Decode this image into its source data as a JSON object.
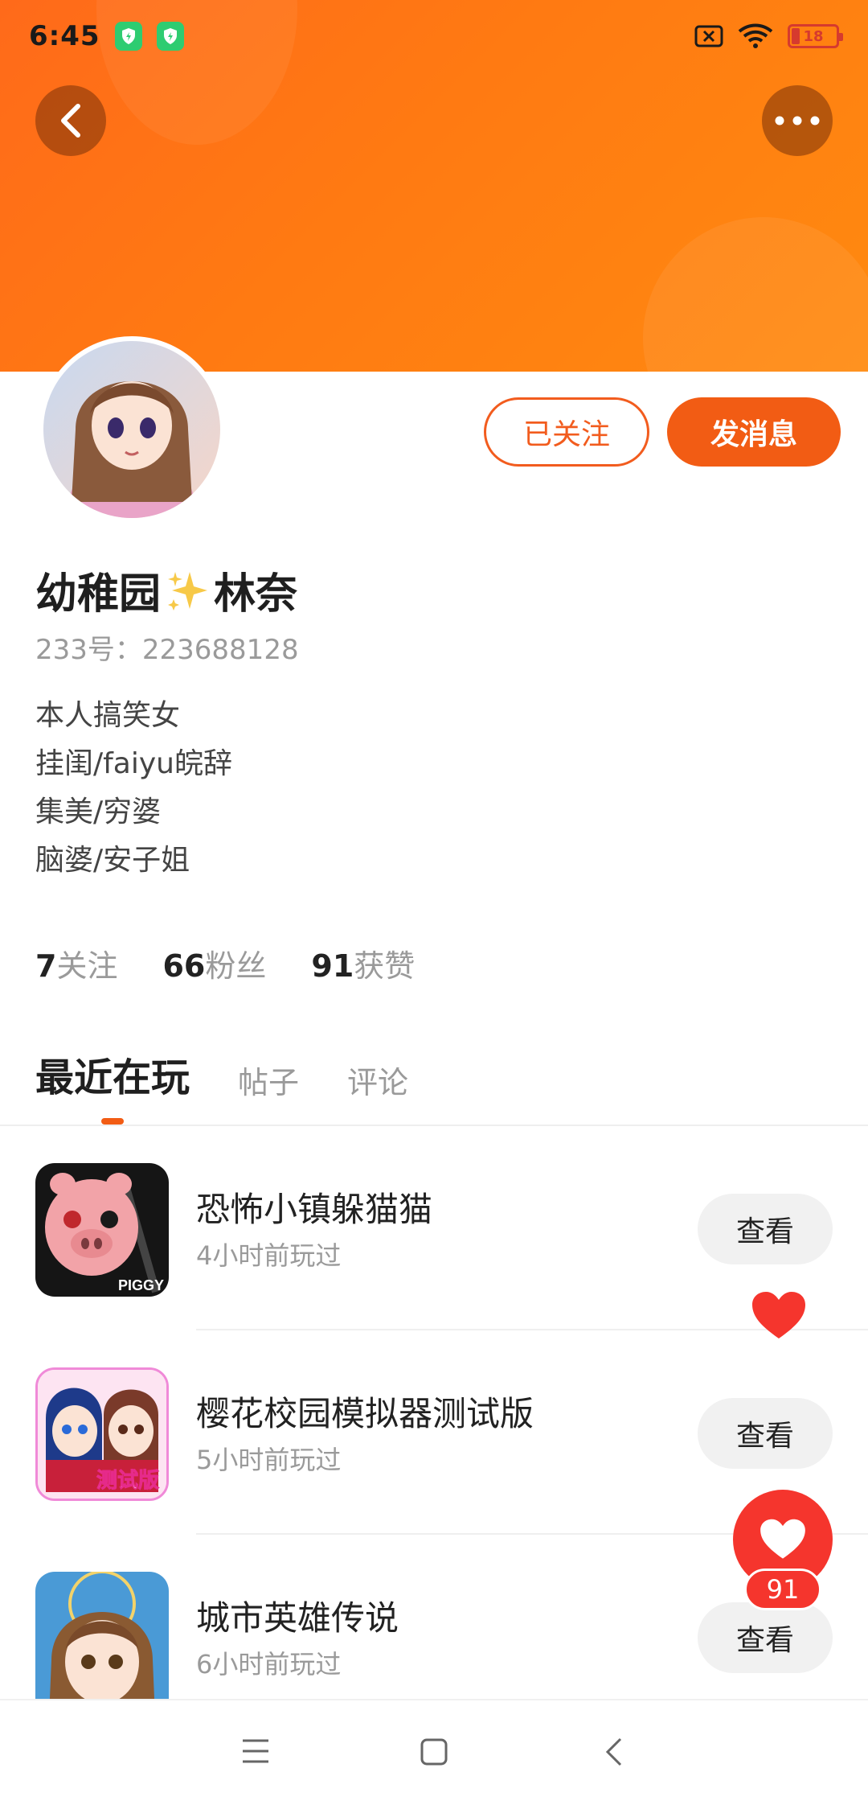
{
  "status_bar": {
    "time": "6:45",
    "battery": "18"
  },
  "header": {
    "back_icon": "chevron-left-icon",
    "more_icon": "more-dots-icon"
  },
  "profile": {
    "name_part1": "幼稚园",
    "name_part2": "林奈",
    "uid": "233号：223688128",
    "bio": [
      "本人搞笑女",
      "挂闺/faiyu皖辞",
      "集美/穷婆",
      "脑婆/安子姐"
    ],
    "follow_label": "已关注",
    "message_label": "发消息",
    "stats": [
      {
        "num": "7",
        "label": "关注"
      },
      {
        "num": "66",
        "label": "粉丝"
      },
      {
        "num": "91",
        "label": "获赞"
      }
    ]
  },
  "tabs": [
    "最近在玩",
    "帖子",
    "评论"
  ],
  "games": [
    {
      "title": "恐怖小镇躲猫猫",
      "sub": "4小时前玩过",
      "action": "查看",
      "icon_text": "PIGGY"
    },
    {
      "title": "樱花校园模拟器测试版",
      "sub": "5小时前玩过",
      "action": "查看",
      "icon_text": "测试版"
    },
    {
      "title": "城市英雄传说",
      "sub": "6小时前玩过",
      "action": "查看"
    }
  ],
  "like_count": "91",
  "colors": {
    "accent": "#f25c14",
    "heart": "#f5352d"
  }
}
